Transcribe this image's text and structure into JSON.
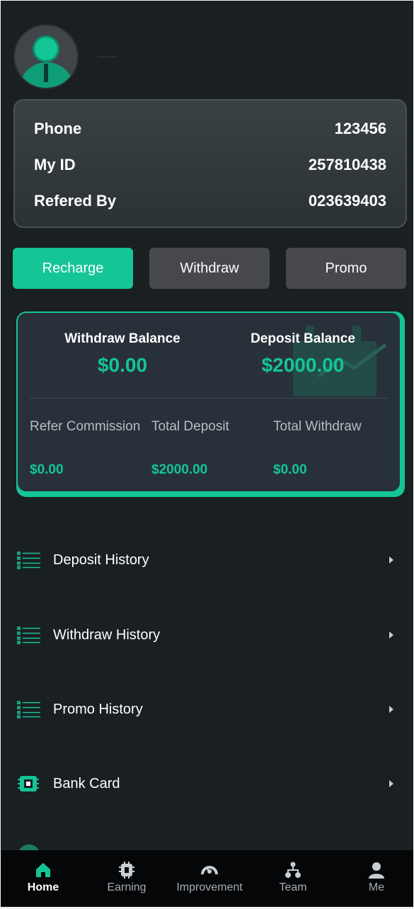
{
  "profile": {
    "username": "· —— ·"
  },
  "info": {
    "rows": [
      {
        "label": "Phone",
        "value": "123456"
      },
      {
        "label": "My ID",
        "value": "257810438"
      },
      {
        "label": "Refered By",
        "value": "023639403"
      }
    ]
  },
  "actions": {
    "recharge": "Recharge",
    "withdraw": "Withdraw",
    "promo": "Promo"
  },
  "balance": {
    "withdraw_title": "Withdraw Balance",
    "withdraw_value": "$0.00",
    "deposit_title": "Deposit Balance",
    "deposit_value": "$2000.00",
    "stats": [
      {
        "label": "Refer Commission",
        "value": "$0.00"
      },
      {
        "label": "Total Deposit",
        "value": "$2000.00"
      },
      {
        "label": "Total Withdraw",
        "value": "$0.00"
      }
    ]
  },
  "menu": [
    {
      "label": "Deposit History",
      "icon": "list-icon"
    },
    {
      "label": "Withdraw History",
      "icon": "list-icon"
    },
    {
      "label": "Promo History",
      "icon": "list-icon"
    },
    {
      "label": "Bank Card",
      "icon": "chip-icon"
    }
  ],
  "nav": [
    {
      "label": "Home",
      "icon": "home-icon",
      "active": true
    },
    {
      "label": "Earning",
      "icon": "chip-icon"
    },
    {
      "label": "Improvement",
      "icon": "gauge-icon"
    },
    {
      "label": "Team",
      "icon": "team-icon"
    },
    {
      "label": "Me",
      "icon": "user-icon"
    }
  ],
  "colors": {
    "accent": "#14c596",
    "background": "#1a1f22",
    "nav_bg": "#050607"
  }
}
